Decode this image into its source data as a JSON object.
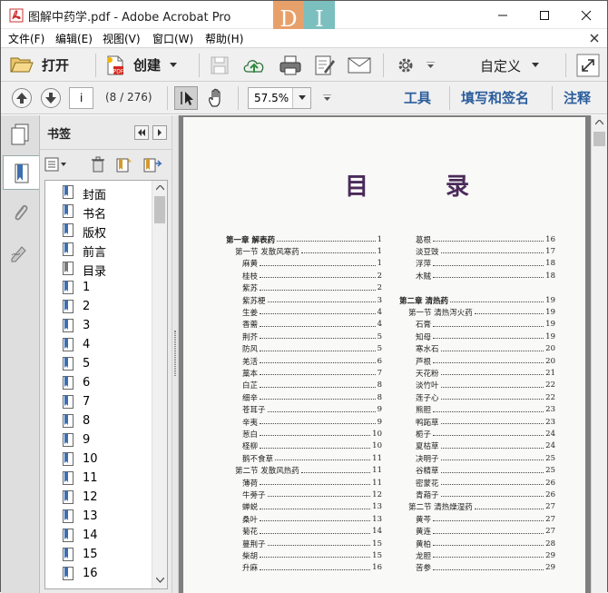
{
  "window": {
    "title": "图解中药学.pdf - Adobe Acrobat Pro",
    "controls": {
      "minimize": "—",
      "maximize": "☐",
      "close": "✕"
    }
  },
  "menu": [
    "文件(F)",
    "编辑(E)",
    "视图(V)",
    "窗口(W)",
    "帮助(H)"
  ],
  "toolbar": {
    "open_label": "打开",
    "create_label": "创建",
    "customize_label": "自定义"
  },
  "nav": {
    "page_input": "i",
    "page_count": "(8 / 276)",
    "zoom": "57.5%",
    "links": [
      "工具",
      "填写和签名",
      "注释"
    ]
  },
  "bookmarks": {
    "title": "书签",
    "items": [
      "封面",
      "书名",
      "版权",
      "前言",
      "目录",
      "1",
      "2",
      "3",
      "4",
      "5",
      "6",
      "7",
      "8",
      "9",
      "10",
      "11",
      "12",
      "13",
      "14",
      "15",
      "16"
    ],
    "selected_index": 4
  },
  "document": {
    "toc_title": "目  录",
    "left_column": [
      {
        "level": 0,
        "text": "第一章  解表药",
        "page": "1"
      },
      {
        "level": 1,
        "text": "第一节  发散风寒药",
        "page": "1"
      },
      {
        "level": 2,
        "text": "麻黄",
        "page": "1"
      },
      {
        "level": 2,
        "text": "桂枝",
        "page": "2"
      },
      {
        "level": 2,
        "text": "紫苏",
        "page": "2"
      },
      {
        "level": 2,
        "text": "紫苏梗",
        "page": "3"
      },
      {
        "level": 2,
        "text": "生姜",
        "page": "4"
      },
      {
        "level": 2,
        "text": "香薷",
        "page": "4"
      },
      {
        "level": 2,
        "text": "荆芥",
        "page": "5"
      },
      {
        "level": 2,
        "text": "防风",
        "page": "5"
      },
      {
        "level": 2,
        "text": "羌活",
        "page": "6"
      },
      {
        "level": 2,
        "text": "藁本",
        "page": "7"
      },
      {
        "level": 2,
        "text": "白芷",
        "page": "8"
      },
      {
        "level": 2,
        "text": "细辛",
        "page": "8"
      },
      {
        "level": 2,
        "text": "苍耳子",
        "page": "9"
      },
      {
        "level": 2,
        "text": "辛夷",
        "page": "9"
      },
      {
        "level": 2,
        "text": "葱白",
        "page": "10"
      },
      {
        "level": 2,
        "text": "柽柳",
        "page": "10"
      },
      {
        "level": 2,
        "text": "鹅不食草",
        "page": "11"
      },
      {
        "level": 1,
        "text": "第二节  发散风热药",
        "page": "11"
      },
      {
        "level": 2,
        "text": "薄荷",
        "page": "11"
      },
      {
        "level": 2,
        "text": "牛蒡子",
        "page": "12"
      },
      {
        "level": 2,
        "text": "蝉蜕",
        "page": "13"
      },
      {
        "level": 2,
        "text": "桑叶",
        "page": "13"
      },
      {
        "level": 2,
        "text": "菊花",
        "page": "14"
      },
      {
        "level": 2,
        "text": "蔓荆子",
        "page": "15"
      },
      {
        "level": 2,
        "text": "柴胡",
        "page": "15"
      },
      {
        "level": 2,
        "text": "升麻",
        "page": "16"
      }
    ],
    "right_column": [
      {
        "level": 2,
        "text": "葛根",
        "page": "16"
      },
      {
        "level": 2,
        "text": "淡豆豉",
        "page": "17"
      },
      {
        "level": 2,
        "text": "浮萍",
        "page": "18"
      },
      {
        "level": 2,
        "text": "木贼",
        "page": "18"
      },
      {
        "level": -1,
        "text": "",
        "page": ""
      },
      {
        "level": 0,
        "text": "第二章  清热药",
        "page": "19"
      },
      {
        "level": 1,
        "text": "第一节  清热泻火药",
        "page": "19"
      },
      {
        "level": 2,
        "text": "石膏",
        "page": "19"
      },
      {
        "level": 2,
        "text": "知母",
        "page": "19"
      },
      {
        "level": 2,
        "text": "寒水石",
        "page": "20"
      },
      {
        "level": 2,
        "text": "芦根",
        "page": "20"
      },
      {
        "level": 2,
        "text": "天花粉",
        "page": "21"
      },
      {
        "level": 2,
        "text": "淡竹叶",
        "page": "22"
      },
      {
        "level": 2,
        "text": "莲子心",
        "page": "22"
      },
      {
        "level": 2,
        "text": "熊胆",
        "page": "23"
      },
      {
        "level": 2,
        "text": "鸭跖草",
        "page": "23"
      },
      {
        "level": 2,
        "text": "栀子",
        "page": "24"
      },
      {
        "level": 2,
        "text": "夏枯草",
        "page": "24"
      },
      {
        "level": 2,
        "text": "决明子",
        "page": "25"
      },
      {
        "level": 2,
        "text": "谷精草",
        "page": "25"
      },
      {
        "level": 2,
        "text": "密蒙花",
        "page": "26"
      },
      {
        "level": 2,
        "text": "青葙子",
        "page": "26"
      },
      {
        "level": 1,
        "text": "第二节  清热燥湿药",
        "page": "27"
      },
      {
        "level": 2,
        "text": "黄芩",
        "page": "27"
      },
      {
        "level": 2,
        "text": "黄连",
        "page": "27"
      },
      {
        "level": 2,
        "text": "黄柏",
        "page": "28"
      },
      {
        "level": 2,
        "text": "龙胆",
        "page": "29"
      },
      {
        "level": 2,
        "text": "苦参",
        "page": "29"
      }
    ]
  },
  "colors": {
    "link": "#2b5d9c",
    "toc_title": "#4a2a5a",
    "doc_bg": "#7f7f7f"
  }
}
